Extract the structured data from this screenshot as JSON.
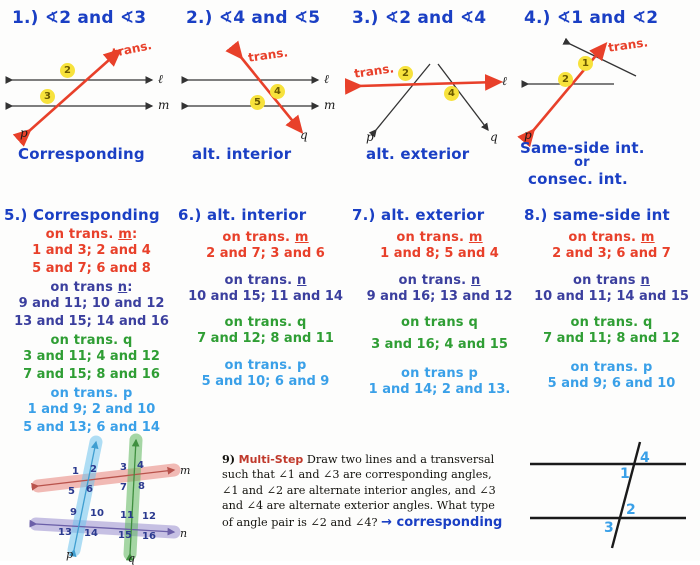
{
  "problems": [
    {
      "prompt": "1.) ∢2 and ∢3",
      "answer": "Corresponding",
      "transversal_label": "trans.",
      "line_labels": [
        "ℓ",
        "m",
        "p"
      ],
      "angles": [
        "2",
        "3"
      ]
    },
    {
      "prompt": "2.) ∢4 and ∢5",
      "answer": "alt. interior",
      "transversal_label": "trans.",
      "line_labels": [
        "ℓ",
        "m",
        "q"
      ],
      "angles": [
        "4",
        "5"
      ]
    },
    {
      "prompt": "3.) ∢2 and ∢4",
      "answer": "alt. exterior",
      "transversal_label": "trans.",
      "line_labels": [
        "ℓ",
        "p",
        "q"
      ],
      "angles": [
        "2",
        "4"
      ]
    },
    {
      "prompt": "4.) ∢1 and ∢2",
      "answer_line1": "Same-side int.",
      "answer_line2": "or",
      "answer_line3": "consec. int.",
      "transversal_label": "trans.",
      "line_labels": [
        "p"
      ],
      "angles": [
        "1",
        "2"
      ]
    }
  ],
  "lists": [
    {
      "heading": "5.) Corresponding",
      "groups": [
        {
          "label_pre": "on trans. ",
          "label_line": "m",
          "label_post": ":",
          "color": "red",
          "rows": [
            "1 and 3;  2 and 4",
            "5 and 7;  6 and 8"
          ]
        },
        {
          "label_pre": "on trans ",
          "label_line": "n",
          "label_post": ":",
          "color": "navy",
          "rows": [
            "9 and 11;  10 and 12",
            "13 and 15;  14 and 16"
          ]
        },
        {
          "label_pre": "on trans. ",
          "label_line": "q",
          "label_post": "",
          "color": "green",
          "rows": [
            "3 and 11;  4 and 12",
            "7 and 15;  8 and 16"
          ]
        },
        {
          "label_pre": "on trans. ",
          "label_line": "p",
          "label_post": "",
          "color": "cyan",
          "rows": [
            "1 and 9;  2 and 10",
            "5 and 13;  6 and 14"
          ]
        }
      ]
    },
    {
      "heading": "6.) alt. interior",
      "groups": [
        {
          "label_pre": "on trans. ",
          "label_line": "m",
          "label_post": "",
          "color": "red",
          "rows": [
            "2 and 7;  3 and 6"
          ]
        },
        {
          "label_pre": "on trans. ",
          "label_line": "n",
          "label_post": "",
          "color": "navy",
          "rows": [
            "10 and 15;  11 and 14"
          ]
        },
        {
          "label_pre": "on trans. ",
          "label_line": "q",
          "label_post": "",
          "color": "green",
          "rows": [
            "7 and 12;  8 and 11"
          ]
        },
        {
          "label_pre": "on trans. ",
          "label_line": "p",
          "label_post": "",
          "color": "cyan",
          "rows": [
            "5 and 10;  6 and 9"
          ]
        }
      ]
    },
    {
      "heading": "7.) alt. exterior",
      "groups": [
        {
          "label_pre": "on trans. ",
          "label_line": "m",
          "label_post": "",
          "color": "red",
          "rows": [
            "1 and 8;  5 and 4"
          ]
        },
        {
          "label_pre": "on trans. ",
          "label_line": "n",
          "label_post": "",
          "color": "navy",
          "rows": [
            "9 and 16;  13 and 12"
          ]
        },
        {
          "label_pre": "on trans ",
          "label_line": "q",
          "label_post": "",
          "color": "green",
          "rows": [
            "3 and 16;  4 and 15"
          ]
        },
        {
          "label_pre": "on trans ",
          "label_line": "p",
          "label_post": "",
          "color": "cyan",
          "rows": [
            "1 and 14;  2 and 13."
          ]
        }
      ]
    },
    {
      "heading": "8.) same-side int",
      "groups": [
        {
          "label_pre": "on trans. ",
          "label_line": "m",
          "label_post": "",
          "color": "red",
          "rows": [
            "2 and 3;  6 and 7"
          ]
        },
        {
          "label_pre": "on trans ",
          "label_line": "n",
          "label_post": "",
          "color": "navy",
          "rows": [
            "10 and 11;  14 and 15"
          ]
        },
        {
          "label_pre": "on trans. ",
          "label_line": "q",
          "label_post": "",
          "color": "green",
          "rows": [
            "7 and 11;  8 and 12"
          ]
        },
        {
          "label_pre": "on trans. ",
          "label_line": "p",
          "label_post": "",
          "color": "cyan",
          "rows": [
            "5 and 9;  6 and 10"
          ]
        }
      ]
    }
  ],
  "figure16": {
    "line_labels": {
      "m": "m",
      "n": "n",
      "p": "p",
      "q": "q"
    },
    "angle_numbers": [
      "1",
      "2",
      "3",
      "4",
      "5",
      "6",
      "7",
      "8",
      "9",
      "10",
      "11",
      "12",
      "13",
      "14",
      "15",
      "16"
    ],
    "colors": {
      "m": "#e8857c",
      "n": "#9a8fd0",
      "p": "#6fc4ef",
      "q": "#5eb85e"
    }
  },
  "question9": {
    "number": "9)",
    "tag": "Multi-Step",
    "body": "Draw two lines and a transversal such that ∠1 and ∠3 are corresponding angles, ∠1 and ∠2 are alternate interior angles, and ∠3 and ∠4 are alternate exterior angles. What type of angle pair is ∠2 and ∠4?",
    "answer": "→ corresponding"
  },
  "answer_figure": {
    "angle_numbers": [
      "1",
      "2",
      "3",
      "4"
    ]
  },
  "palette": {
    "blue": "#1a3fc4",
    "red": "#e8402a",
    "navy": "#3b3f9e",
    "green": "#2f9e34",
    "cyan": "#3aa0e8",
    "highlight": "#f7e23c"
  }
}
